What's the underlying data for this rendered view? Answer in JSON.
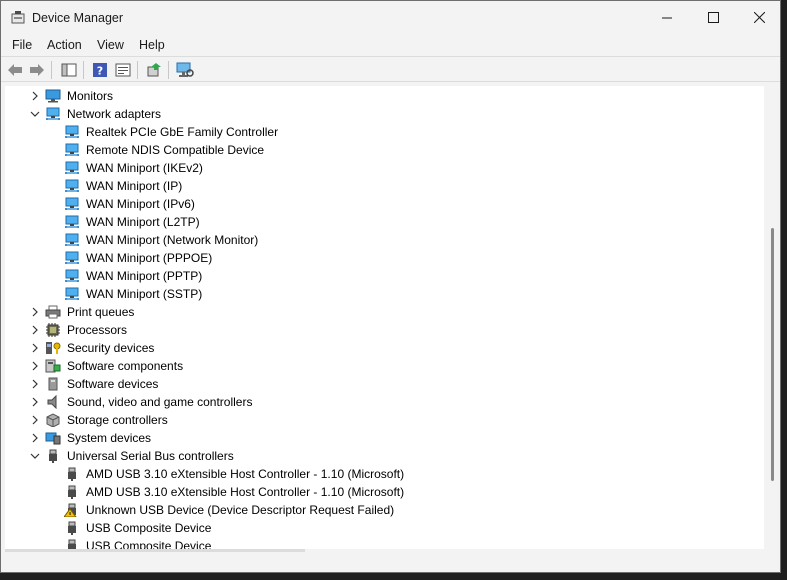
{
  "window": {
    "title": "Device Manager"
  },
  "menu": [
    "File",
    "Action",
    "View",
    "Help"
  ],
  "toolbar_icons": [
    "back-icon",
    "forward-icon",
    "show-hide-console-tree-icon",
    "help-icon",
    "properties-icon",
    "update-driver-icon",
    "scan-hardware-icon"
  ],
  "tree": [
    {
      "label": "Monitors",
      "level": 0,
      "expanded": false,
      "icon": "monitor-icon"
    },
    {
      "label": "Network adapters",
      "level": 0,
      "expanded": true,
      "icon": "network-adapter-icon"
    },
    {
      "label": "Realtek PCIe GbE Family Controller",
      "level": 1,
      "icon": "network-adapter-icon"
    },
    {
      "label": "Remote NDIS Compatible Device",
      "level": 1,
      "icon": "network-adapter-icon"
    },
    {
      "label": "WAN Miniport (IKEv2)",
      "level": 1,
      "icon": "network-adapter-icon"
    },
    {
      "label": "WAN Miniport (IP)",
      "level": 1,
      "icon": "network-adapter-icon"
    },
    {
      "label": "WAN Miniport (IPv6)",
      "level": 1,
      "icon": "network-adapter-icon"
    },
    {
      "label": "WAN Miniport (L2TP)",
      "level": 1,
      "icon": "network-adapter-icon"
    },
    {
      "label": "WAN Miniport (Network Monitor)",
      "level": 1,
      "icon": "network-adapter-icon"
    },
    {
      "label": "WAN Miniport (PPPOE)",
      "level": 1,
      "icon": "network-adapter-icon"
    },
    {
      "label": "WAN Miniport (PPTP)",
      "level": 1,
      "icon": "network-adapter-icon"
    },
    {
      "label": "WAN Miniport (SSTP)",
      "level": 1,
      "icon": "network-adapter-icon"
    },
    {
      "label": "Print queues",
      "level": 0,
      "expanded": false,
      "icon": "printer-icon"
    },
    {
      "label": "Processors",
      "level": 0,
      "expanded": false,
      "icon": "processor-icon"
    },
    {
      "label": "Security devices",
      "level": 0,
      "expanded": false,
      "icon": "security-device-icon"
    },
    {
      "label": "Software components",
      "level": 0,
      "expanded": false,
      "icon": "software-component-icon"
    },
    {
      "label": "Software devices",
      "level": 0,
      "expanded": false,
      "icon": "software-device-icon"
    },
    {
      "label": "Sound, video and game controllers",
      "level": 0,
      "expanded": false,
      "icon": "speaker-icon"
    },
    {
      "label": "Storage controllers",
      "level": 0,
      "expanded": false,
      "icon": "storage-controller-icon"
    },
    {
      "label": "System devices",
      "level": 0,
      "expanded": false,
      "icon": "system-device-icon"
    },
    {
      "label": "Universal Serial Bus controllers",
      "level": 0,
      "expanded": true,
      "icon": "usb-icon"
    },
    {
      "label": "AMD USB 3.10 eXtensible Host Controller - 1.10 (Microsoft)",
      "level": 1,
      "icon": "usb-icon"
    },
    {
      "label": "AMD USB 3.10 eXtensible Host Controller - 1.10 (Microsoft)",
      "level": 1,
      "icon": "usb-icon"
    },
    {
      "label": "Unknown USB Device (Device Descriptor Request Failed)",
      "level": 1,
      "icon": "usb-warning-icon"
    },
    {
      "label": "USB Composite Device",
      "level": 1,
      "icon": "usb-icon"
    },
    {
      "label": "USB Composite Device",
      "level": 1,
      "icon": "usb-icon"
    }
  ],
  "colors": {
    "accent": "#2e8fd8",
    "warning": "#f2c200",
    "window_bg": "#f3f3f3"
  }
}
